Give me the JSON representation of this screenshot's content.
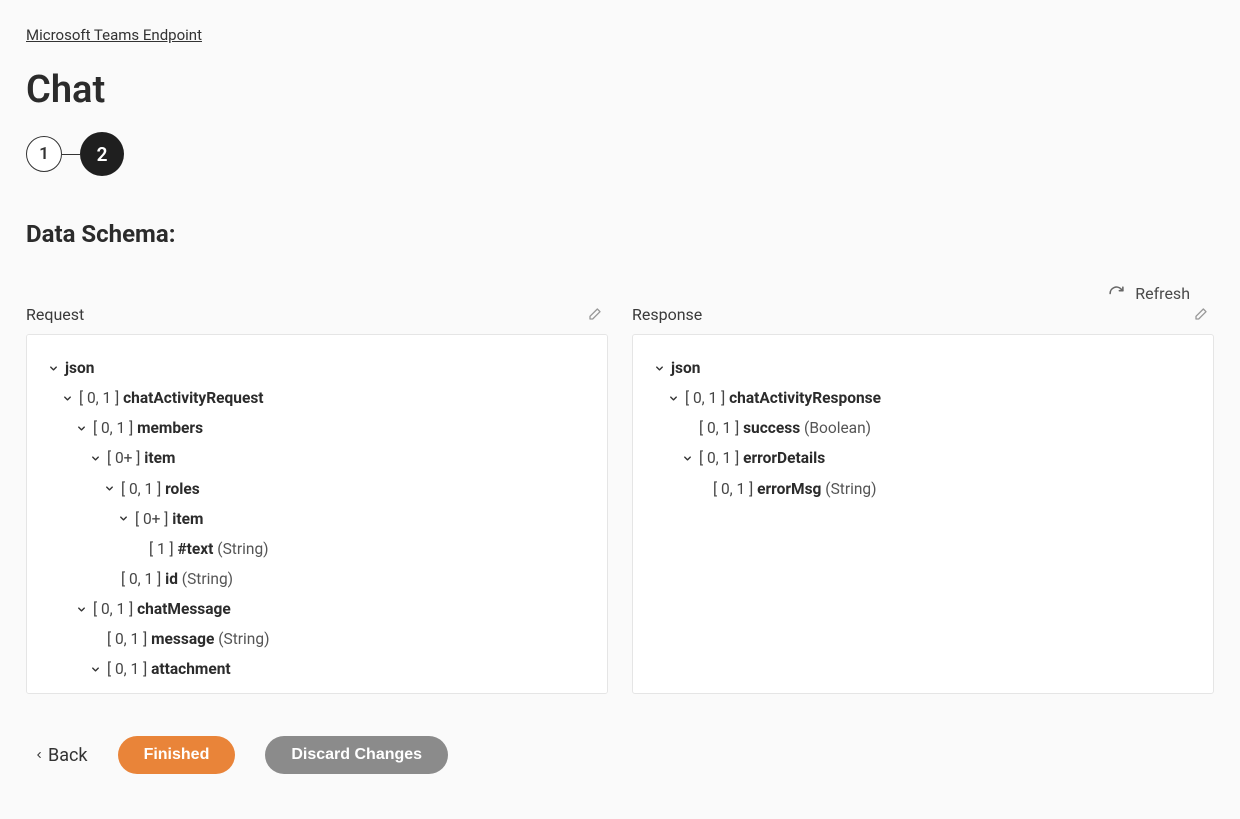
{
  "breadcrumb": "Microsoft Teams Endpoint",
  "page_title": "Chat",
  "stepper": {
    "step1": "1",
    "step2": "2"
  },
  "section_title": "Data Schema:",
  "refresh_label": "Refresh",
  "panels": {
    "request_label": "Request",
    "response_label": "Response"
  },
  "request_tree": [
    {
      "indent": 0,
      "expand": true,
      "card": "",
      "name": "json",
      "type": ""
    },
    {
      "indent": 1,
      "expand": true,
      "card": "[ 0, 1 ]",
      "name": "chatActivityRequest",
      "type": ""
    },
    {
      "indent": 2,
      "expand": true,
      "card": "[ 0, 1 ]",
      "name": "members",
      "type": ""
    },
    {
      "indent": 3,
      "expand": true,
      "card": "[ 0+ ]",
      "name": "item",
      "type": ""
    },
    {
      "indent": 4,
      "expand": true,
      "card": "[ 0, 1 ]",
      "name": "roles",
      "type": ""
    },
    {
      "indent": 5,
      "expand": true,
      "card": "[ 0+ ]",
      "name": "item",
      "type": ""
    },
    {
      "indent": 6,
      "expand": false,
      "card": "[ 1 ]",
      "name": "#text",
      "type": "(String)"
    },
    {
      "indent": 4,
      "expand": false,
      "card": "[ 0, 1 ]",
      "name": "id",
      "type": "(String)"
    },
    {
      "indent": 2,
      "expand": true,
      "card": "[ 0, 1 ]",
      "name": "chatMessage",
      "type": ""
    },
    {
      "indent": 3,
      "expand": false,
      "card": "[ 0, 1 ]",
      "name": "message",
      "type": "(String)"
    },
    {
      "indent": 3,
      "expand": true,
      "card": "[ 0, 1 ]",
      "name": "attachment",
      "type": ""
    }
  ],
  "response_tree": [
    {
      "indent": 0,
      "expand": true,
      "card": "",
      "name": "json",
      "type": ""
    },
    {
      "indent": 1,
      "expand": true,
      "card": "[ 0, 1 ]",
      "name": "chatActivityResponse",
      "type": ""
    },
    {
      "indent": 2,
      "expand": false,
      "card": "[ 0, 1 ]",
      "name": "success",
      "type": "(Boolean)"
    },
    {
      "indent": 2,
      "expand": true,
      "card": "[ 0, 1 ]",
      "name": "errorDetails",
      "type": ""
    },
    {
      "indent": 3,
      "expand": false,
      "card": "[ 0, 1 ]",
      "name": "errorMsg",
      "type": "(String)"
    }
  ],
  "footer": {
    "back": "Back",
    "finished": "Finished",
    "discard": "Discard Changes"
  }
}
